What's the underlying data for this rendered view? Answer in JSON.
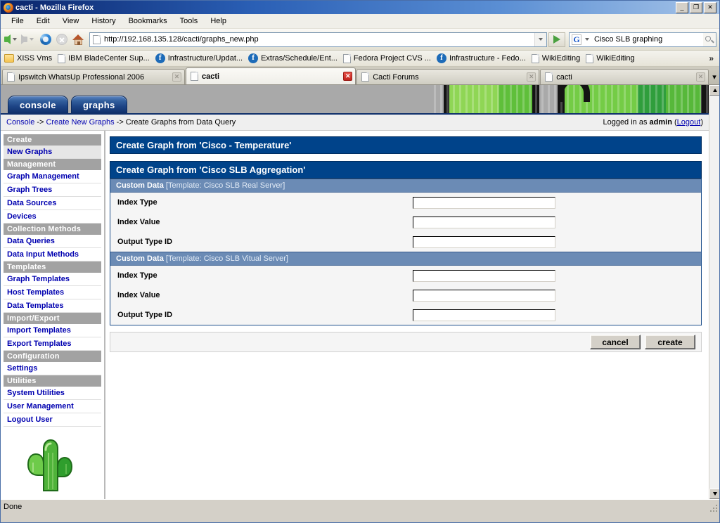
{
  "window": {
    "title": "cacti - Mozilla Firefox",
    "minimize_label": "_",
    "maximize_label": "❐",
    "close_label": "✕"
  },
  "menubar": {
    "items": [
      "File",
      "Edit",
      "View",
      "History",
      "Bookmarks",
      "Tools",
      "Help"
    ]
  },
  "navbar": {
    "url": "http://192.168.135.128/cacti/graphs_new.php",
    "search_value": "Cisco SLB graphing",
    "search_engine": "G",
    "back_label": "Back",
    "forward_label": "Forward",
    "reload_label": "Reload",
    "stop_label": "Stop",
    "home_label": "Home",
    "go_label": "Go"
  },
  "bookmarks": {
    "items": [
      {
        "label": "XISS Vms",
        "icon": "folder-icon"
      },
      {
        "label": "IBM BladeCenter Sup...",
        "icon": "document-icon"
      },
      {
        "label": "Infrastructure/Updat...",
        "icon": "fedora-icon"
      },
      {
        "label": "Extras/Schedule/Ent...",
        "icon": "fedora-icon"
      },
      {
        "label": "Fedora Project CVS ...",
        "icon": "document-icon"
      },
      {
        "label": "Infrastructure - Fedo...",
        "icon": "fedora-icon"
      },
      {
        "label": "WikiEditing",
        "icon": "document-icon"
      },
      {
        "label": "WikiEditing",
        "icon": "document-icon"
      }
    ],
    "overflow_label": "»"
  },
  "tabs": {
    "items": [
      {
        "label": "Ipswitch WhatsUp Professional 2006",
        "active": false
      },
      {
        "label": "cacti",
        "active": true
      },
      {
        "label": "Cacti Forums",
        "active": false
      },
      {
        "label": "cacti",
        "active": false
      }
    ],
    "close_label": "✕",
    "list_all_label": "▾"
  },
  "cacti": {
    "nav_tabs": [
      {
        "label": "console"
      },
      {
        "label": "graphs"
      }
    ],
    "breadcrumb": {
      "console": "Console",
      "sep1": "->",
      "create_new_graphs": "Create New Graphs",
      "sep2": "->",
      "current": "Create Graphs from Data Query"
    },
    "login": {
      "prefix": "Logged in as ",
      "user": "admin",
      "open_paren": " (",
      "logout": "Logout",
      "close_paren": ")"
    },
    "sidebar": [
      {
        "type": "header",
        "label": "Create"
      },
      {
        "type": "link",
        "label": "New Graphs",
        "selected": true
      },
      {
        "type": "header",
        "label": "Management"
      },
      {
        "type": "link",
        "label": "Graph Management",
        "selected": false
      },
      {
        "type": "link",
        "label": "Graph Trees",
        "selected": false
      },
      {
        "type": "link",
        "label": "Data Sources",
        "selected": false
      },
      {
        "type": "link",
        "label": "Devices",
        "selected": false
      },
      {
        "type": "header",
        "label": "Collection Methods"
      },
      {
        "type": "link",
        "label": "Data Queries",
        "selected": false
      },
      {
        "type": "link",
        "label": "Data Input Methods",
        "selected": false
      },
      {
        "type": "header",
        "label": "Templates"
      },
      {
        "type": "link",
        "label": "Graph Templates",
        "selected": false
      },
      {
        "type": "link",
        "label": "Host Templates",
        "selected": false
      },
      {
        "type": "link",
        "label": "Data Templates",
        "selected": false
      },
      {
        "type": "header",
        "label": "Import/Export"
      },
      {
        "type": "link",
        "label": "Import Templates",
        "selected": false
      },
      {
        "type": "link",
        "label": "Export Templates",
        "selected": false
      },
      {
        "type": "header",
        "label": "Configuration"
      },
      {
        "type": "link",
        "label": "Settings",
        "selected": false
      },
      {
        "type": "header",
        "label": "Utilities"
      },
      {
        "type": "link",
        "label": "System Utilities",
        "selected": false
      },
      {
        "type": "link",
        "label": "User Management",
        "selected": false
      },
      {
        "type": "link",
        "label": "Logout User",
        "selected": false
      }
    ],
    "panel_a": {
      "title": "Create Graph from 'Cisco - Temperature'"
    },
    "panel_b": {
      "title": "Create Graph from 'Cisco SLB Aggregation'",
      "sections": [
        {
          "head_bold": "Custom Data",
          "head_template": " [Template: Cisco SLB Real Server]",
          "rows": [
            {
              "label": "Index Type",
              "value": ""
            },
            {
              "label": "Index Value",
              "value": ""
            },
            {
              "label": "Output Type ID",
              "value": ""
            }
          ]
        },
        {
          "head_bold": "Custom Data",
          "head_template": " [Template: Cisco SLB Vitual Server]",
          "rows": [
            {
              "label": "Index Type",
              "value": ""
            },
            {
              "label": "Index Value",
              "value": ""
            },
            {
              "label": "Output Type ID",
              "value": ""
            }
          ]
        }
      ],
      "buttons": {
        "cancel": "cancel",
        "create": "create"
      }
    }
  },
  "statusbar": {
    "text": "Done"
  },
  "colors": {
    "panel_title_bg": "#00438a",
    "subhead_bg": "#6b8bb5",
    "side_header_bg": "#a2a2a2",
    "link": "#0000b0",
    "banner_bg": "#a9a9a9",
    "cactus_green": "#4caf3a"
  }
}
